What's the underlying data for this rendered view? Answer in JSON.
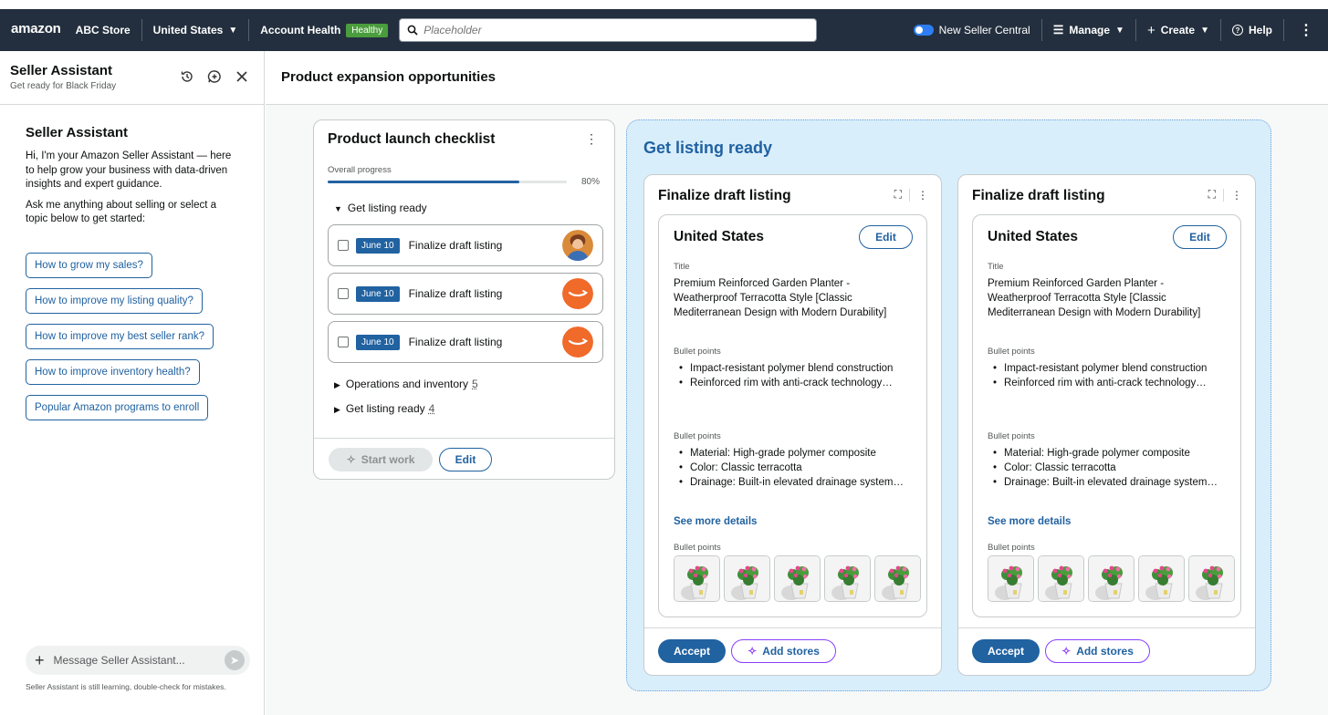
{
  "topnav": {
    "logo": "amazon",
    "store": "ABC Store",
    "country": "United States",
    "account_health_label": "Account Health",
    "account_health_badge": "Healthy",
    "search_placeholder": "Placeholder",
    "new_seller_central": "New Seller Central",
    "manage": "Manage",
    "create": "Create",
    "help": "Help"
  },
  "sidebar": {
    "title": "Seller Assistant",
    "subtitle": "Get ready for Black Friday",
    "body_title": "Seller Assistant",
    "intro": "Hi, I'm your Amazon Seller Assistant — here to help grow your business with data-driven insights and expert guidance.",
    "prompt": "Ask me anything about selling or select a topic below to get started:",
    "chips": [
      "How to grow my sales?",
      "How to improve my listing quality?",
      "How to improve my best seller rank?",
      "How to improve inventory health?",
      "Popular Amazon programs to enroll"
    ],
    "message_placeholder": "Message Seller Assistant...",
    "disclaimer": "Seller Assistant is still learning, double-check for mistakes."
  },
  "main": {
    "title": "Product expansion opportunities"
  },
  "checklist": {
    "title": "Product launch checklist",
    "progress_label": "Overall progress",
    "progress_value": 0.8,
    "progress_text": "80%",
    "section_open": "Get listing ready",
    "tasks": [
      {
        "date": "June 10",
        "label": "Finalize draft listing",
        "avatar": "person"
      },
      {
        "date": "June 10",
        "label": "Finalize draft listing",
        "avatar": "amazon"
      },
      {
        "date": "June 10",
        "label": "Finalize draft listing",
        "avatar": "amazon"
      }
    ],
    "sections_collapsed": [
      {
        "label": "Operations and inventory",
        "count": "5"
      },
      {
        "label": "Get listing ready",
        "count": "4"
      }
    ],
    "start_work": "Start work",
    "edit": "Edit"
  },
  "listing_panel": {
    "title": "Get listing ready",
    "cards": [
      {
        "title": "Finalize draft listing",
        "country": "United States",
        "edit": "Edit",
        "title_label": "Title",
        "title_value": "Premium Reinforced Garden Planter - Weatherproof Terracotta Style [Classic Mediterranean Design with Modern Durability]",
        "bullets1_label": "Bullet points",
        "bullets1": [
          "Impact-resistant polymer blend construction",
          "Reinforced rim with anti-crack technology…"
        ],
        "bullets2_label": "Bullet points",
        "bullets2": [
          "Material: High-grade polymer composite",
          "Color: Classic terracotta",
          "Drainage: Built-in elevated drainage system…"
        ],
        "see_more": "See more details",
        "images_label": "Bullet points",
        "accept": "Accept",
        "add_stores": "Add stores"
      },
      {
        "title": "Finalize draft listing",
        "country": "United States",
        "edit": "Edit",
        "title_label": "Title",
        "title_value": "Premium Reinforced Garden Planter - Weatherproof Terracotta Style [Classic Mediterranean Design with Modern Durability]",
        "bullets1_label": "Bullet points",
        "bullets1": [
          "Impact-resistant polymer blend construction",
          "Reinforced rim with anti-crack technology…"
        ],
        "bullets2_label": "Bullet points",
        "bullets2": [
          "Material: High-grade polymer composite",
          "Color: Classic terracotta",
          "Drainage: Built-in elevated drainage system…"
        ],
        "see_more": "See more details",
        "images_label": "Bullet points",
        "accept": "Accept",
        "add_stores": "Add stores"
      }
    ]
  },
  "colors": {
    "nav_bg": "#232f3e",
    "accent_blue": "#2162a1",
    "healthy_green": "#4a9d3c",
    "panel_bg": "#d9eefb",
    "amazon_orange": "#f06a2a"
  }
}
